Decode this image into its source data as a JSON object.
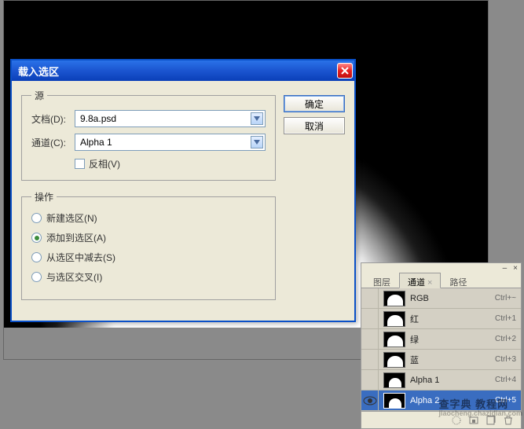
{
  "dialog": {
    "title": "载入选区",
    "source": {
      "legend": "源",
      "document_label": "文档(D):",
      "document_value": "9.8a.psd",
      "channel_label": "通道(C):",
      "channel_value": "Alpha 1",
      "invert_label": "反相(V)"
    },
    "operation": {
      "legend": "操作",
      "options": {
        "new": "新建选区(N)",
        "add": "添加到选区(A)",
        "subtract": "从选区中减去(S)",
        "intersect": "与选区交叉(I)"
      }
    },
    "buttons": {
      "ok": "确定",
      "cancel": "取消"
    }
  },
  "panel": {
    "tabs": {
      "layers": "图层",
      "channels": "通道",
      "paths": "路径"
    },
    "channels": [
      {
        "name": "RGB",
        "shortcut": "Ctrl+~",
        "visible": false,
        "selected": false,
        "alpha": false
      },
      {
        "name": "红",
        "shortcut": "Ctrl+1",
        "visible": false,
        "selected": false,
        "alpha": false
      },
      {
        "name": "绿",
        "shortcut": "Ctrl+2",
        "visible": false,
        "selected": false,
        "alpha": false
      },
      {
        "name": "蓝",
        "shortcut": "Ctrl+3",
        "visible": false,
        "selected": false,
        "alpha": false
      },
      {
        "name": "Alpha 1",
        "shortcut": "Ctrl+4",
        "visible": false,
        "selected": false,
        "alpha": true
      },
      {
        "name": "Alpha 2",
        "shortcut": "Ctrl+5",
        "visible": true,
        "selected": true,
        "alpha": true
      }
    ]
  },
  "watermark": {
    "main": "查字典 教程网",
    "sub": "jiaocheng.chazidian.com"
  }
}
